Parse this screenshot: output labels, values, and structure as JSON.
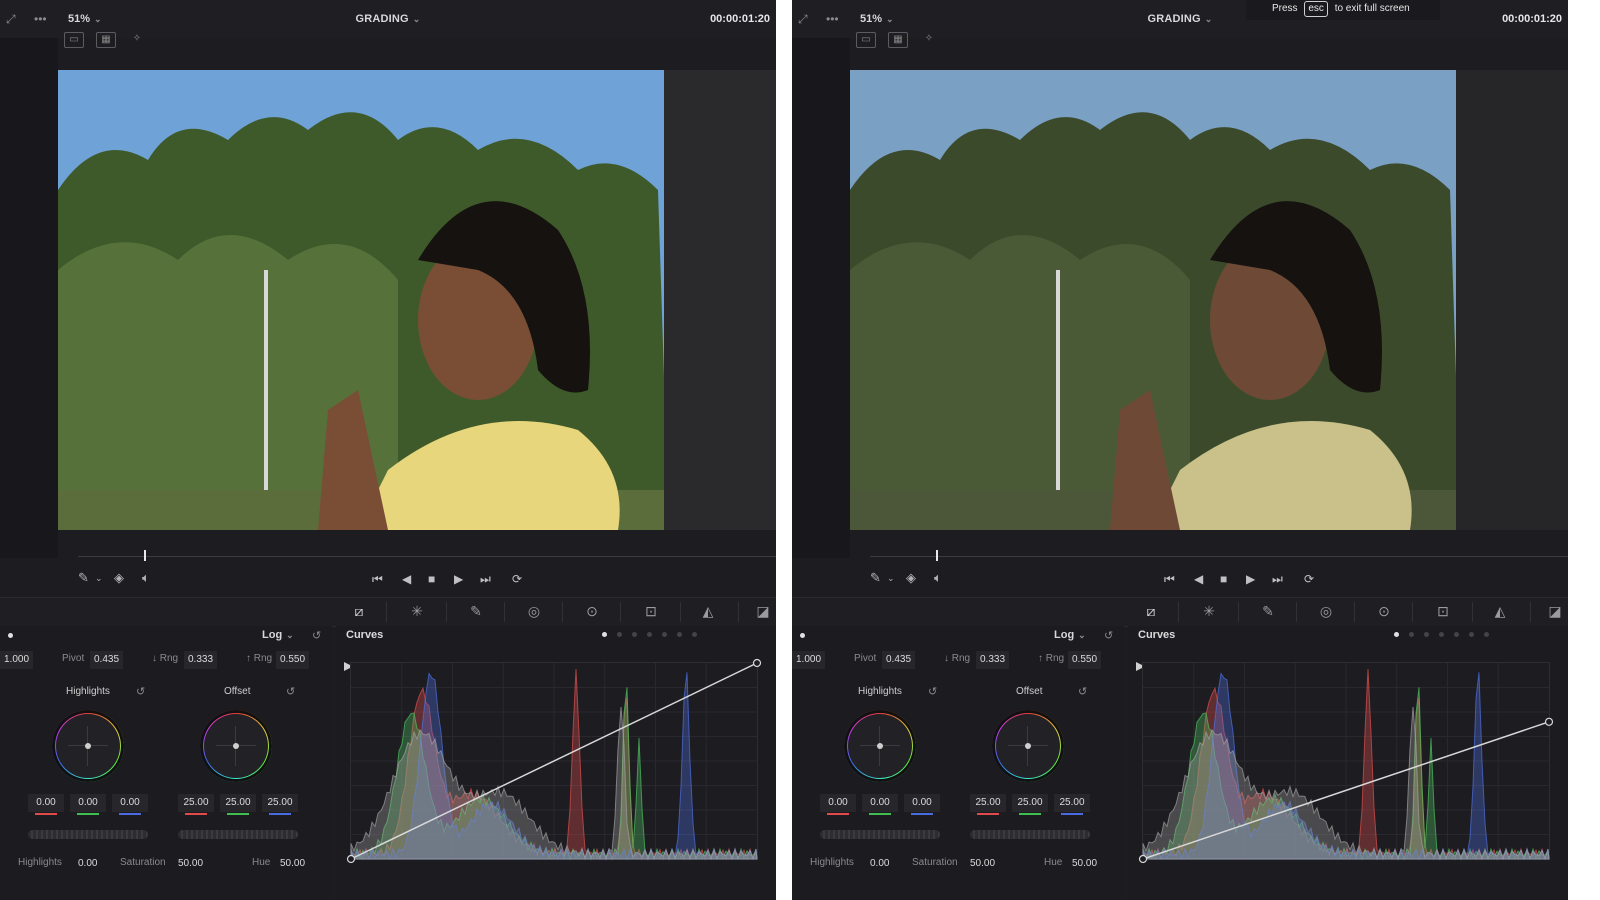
{
  "screens": [
    {
      "id": "left",
      "zoom": "51%",
      "page_title": "GRADING",
      "timecode": "00:00:01:20",
      "primaries": {
        "mode": "Log",
        "contrast": "1.000",
        "pivot_label": "Pivot",
        "pivot": "0.435",
        "low_range_label": "↓ Rng",
        "low_range": "0.333",
        "high_range_label": "↑ Rng",
        "high_range": "0.550",
        "wheels": [
          {
            "label": "Highlights",
            "values": [
              "0.00",
              "0.00",
              "0.00"
            ]
          },
          {
            "label": "Offset",
            "values": [
              "25.00",
              "25.00",
              "25.00"
            ]
          }
        ],
        "bottom": [
          {
            "label": "Highlights",
            "value": "0.00"
          },
          {
            "label": "Saturation",
            "value": "50.00"
          },
          {
            "label": "Hue",
            "value": "50.00"
          }
        ]
      },
      "curves": {
        "title": "Curves",
        "end_input": 1.0,
        "end_output": 1.0
      }
    },
    {
      "id": "right",
      "zoom": "51%",
      "page_title": "GRADING",
      "timecode": "00:00:01:20",
      "primaries": {
        "mode": "Log",
        "contrast": "1.000",
        "pivot_label": "Pivot",
        "pivot": "0.435",
        "low_range_label": "↓ Rng",
        "low_range": "0.333",
        "high_range_label": "↑ Rng",
        "high_range": "0.550",
        "wheels": [
          {
            "label": "Highlights",
            "values": [
              "0.00",
              "0.00",
              "0.00"
            ]
          },
          {
            "label": "Offset",
            "values": [
              "25.00",
              "25.00",
              "25.00"
            ]
          }
        ],
        "bottom": [
          {
            "label": "Highlights",
            "value": "0.00"
          },
          {
            "label": "Saturation",
            "value": "50.00"
          },
          {
            "label": "Hue",
            "value": "50.00"
          }
        ]
      },
      "curves": {
        "title": "Curves",
        "end_input": 1.0,
        "end_output": 0.7
      }
    }
  ],
  "fullscreen_tip": {
    "press": "Press",
    "key": "esc",
    "suffix": "to exit full screen"
  },
  "icons": [
    "expand-icon",
    "more-icon",
    "chevron-down-icon",
    "single-viewer-icon",
    "split-view-icon",
    "magic-wand-icon",
    "eyedropper-icon",
    "layers-icon",
    "speaker-icon",
    "skip-back-icon",
    "step-back-icon",
    "stop-icon",
    "play-icon",
    "skip-forward-icon",
    "loop-icon",
    "curves-icon",
    "color-warper-icon",
    "qualifier-icon",
    "window-icon",
    "tracker-icon",
    "magic-mask-icon",
    "blur-icon",
    "key-icon",
    "reset-icon"
  ],
  "colors": {
    "panel_bg": "#1c1c21",
    "accent_red": "#e04a4a",
    "accent_green": "#3fbf4f",
    "accent_blue": "#4a6ae0",
    "curve_line": "#d8d8d8"
  }
}
